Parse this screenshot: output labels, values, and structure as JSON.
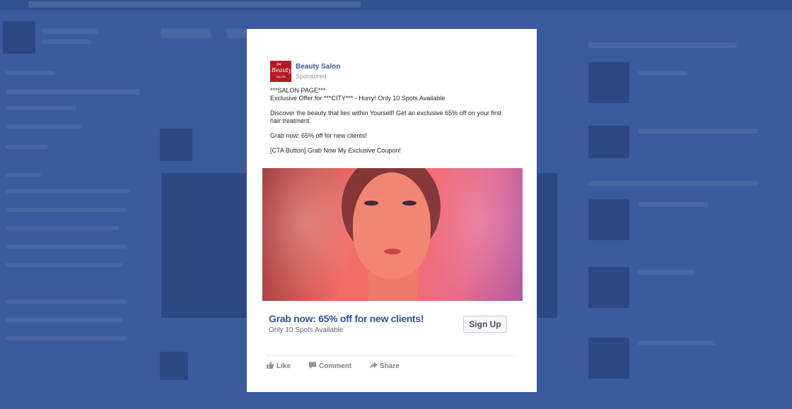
{
  "ad": {
    "page_name": "Beauty Salon",
    "sponsored_label": "Sponsored",
    "logo": {
      "script_text": "Beauty",
      "sub_text": "SALON"
    },
    "body_lines": {
      "line1": "***SALON PAGE***",
      "line2": "Exclusive Offer for ***CITY*** - Hurry! Only 10 Spots Available",
      "line3": "Discover the beauty that lies within Yourself! Get an exclusive 65% off on your first hair treatment.",
      "line4": "Grab now: 65% off for new clients!",
      "line5": "[CTA Button] Grab Now My Exclusive Coupon!"
    },
    "cta": {
      "headline": "Grab now: 65% off for new clients!",
      "subtext": "Only 10 Spots Available",
      "button_label": "Sign Up"
    },
    "actions": {
      "like": "Like",
      "comment": "Comment",
      "share": "Share"
    }
  },
  "colors": {
    "background": "#3c5a9e",
    "brand_red": "#b31b22",
    "link_blue": "#365899",
    "cta_blue": "#2e5596"
  },
  "icons": {
    "like": "thumbs-up-icon",
    "comment": "speech-bubble-icon",
    "share": "share-arrow-icon"
  }
}
